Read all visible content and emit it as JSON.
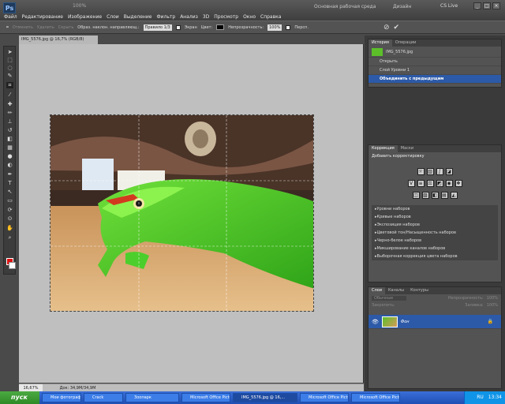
{
  "app": {
    "logo": "Ps",
    "zoom": "100%",
    "workspace_label": "Основная рабочая среда",
    "design_label": "Дизайн",
    "cs_live": "CS Live",
    "menu": [
      "Файл",
      "Редактирование",
      "Изображение",
      "Слои",
      "Выделение",
      "Фильтр",
      "Анализ",
      "3D",
      "Просмотр",
      "Окно",
      "Справка"
    ]
  },
  "options": {
    "btn1": "Отменить",
    "btn2": "Удалить",
    "btn3": "Скрыть",
    "label1": "Образ. наклон. направляющ.:",
    "grid_select": "Правило 1/3",
    "screen_label": "Экран",
    "color_label": "Цвет:",
    "opacity_label": "Непрозрачность:",
    "opacity_value": "100%",
    "perspective_label": "Персп."
  },
  "document": {
    "tab_title": "IMG_5576.jpg @ 16,7% (RGB/8)",
    "status_zoom": "16,67%",
    "status_doc": "Док: 34,9M/34,9M"
  },
  "history": {
    "tabs": [
      "История",
      "Операции"
    ],
    "snapshot": "IMG_5576.jpg",
    "items": [
      "Открыть",
      "Слой Уровни 1",
      "Объединить с предыдущим"
    ]
  },
  "adjustments": {
    "tabs": [
      "Коррекция",
      "Маски"
    ],
    "title": "Добавить корректировку",
    "presets": [
      "Уровни наборов",
      "Кривые наборов",
      "Экспозиция наборов",
      "Цветовой тон/Насыщенность наборов",
      "Черно-белое наборов",
      "Микширование каналов наборов",
      "Выборочная коррекция цвета наборов"
    ]
  },
  "layers": {
    "tabs": [
      "Слои",
      "Каналы",
      "Контуры"
    ],
    "blend_mode": "Обычные",
    "opacity_label": "Непрозрачность:",
    "opacity": "100%",
    "lock_label": "Закрепить:",
    "fill_label": "Заливка:",
    "fill": "100%",
    "layer_name": "Фон"
  },
  "taskbar": {
    "start": "пуск",
    "tasks": [
      "Мои фотографии",
      "Crack",
      "Зоопарк",
      "Microsoft Office Pictu...",
      "IMG_5576.jpg @ 16,...",
      "Microsoft Office Pictu...",
      "Microsoft Office Pictu..."
    ],
    "lang": "RU",
    "time": "13:34"
  },
  "colors": {
    "foreground": "#e01010",
    "background": "#ffffff",
    "selection": "#2d5aa8"
  }
}
